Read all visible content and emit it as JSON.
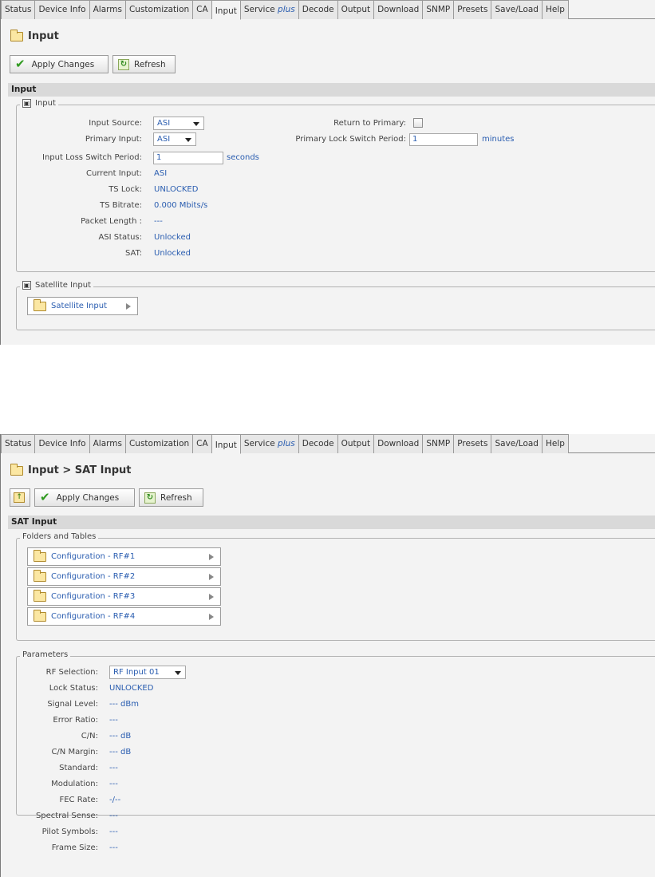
{
  "tabs": [
    {
      "label": "Status"
    },
    {
      "label": "Device Info"
    },
    {
      "label": "Alarms"
    },
    {
      "label": "Customization"
    },
    {
      "label": "CA"
    },
    {
      "label": "Input",
      "active": true
    },
    {
      "label": "Service ",
      "suffix": "plus"
    },
    {
      "label": "Decode"
    },
    {
      "label": "Output"
    },
    {
      "label": "Download"
    },
    {
      "label": "SNMP"
    },
    {
      "label": "Presets"
    },
    {
      "label": "Save/Load"
    },
    {
      "label": "Help"
    }
  ],
  "colors": {
    "value_blue": "#2a5db0",
    "section_gray": "#d9d9d9",
    "check_green": "#2f9a1f"
  },
  "toolbar": {
    "apply_label": "Apply Changes",
    "refresh_label": "Refresh"
  },
  "icons": {
    "folder": "folder-icon",
    "apply": "checkmark-icon",
    "refresh": "refresh-icon",
    "up": "folder-up-icon",
    "collapse": "collapse-icon",
    "expand_arrow": "right-triangle-icon",
    "dropdown_arrow": "chevron-down-icon"
  },
  "panel1": {
    "page_title": "Input",
    "section_title": "Input",
    "input_group": {
      "legend": "Input",
      "input_source": {
        "label": "Input Source:",
        "value": "ASI"
      },
      "primary_input": {
        "label": "Primary Input:",
        "value": "ASI"
      },
      "loss_switch": {
        "label": "Input Loss Switch Period:",
        "value": "1",
        "unit": "seconds"
      },
      "current_input": {
        "label": "Current Input:",
        "value": "ASI"
      },
      "ts_lock": {
        "label": "TS Lock:",
        "value": "UNLOCKED"
      },
      "ts_bitrate": {
        "label": "TS Bitrate:",
        "value": "0.000 Mbits/s"
      },
      "packet_length": {
        "label": "Packet Length :",
        "value": "---"
      },
      "asi_status": {
        "label": "ASI Status:",
        "value": "Unlocked"
      },
      "sat": {
        "label": "SAT:",
        "value": "Unlocked"
      },
      "return_primary": {
        "label": "Return to Primary:",
        "checked": false
      },
      "primary_lock_switch": {
        "label": "Primary Lock Switch Period:",
        "value": "1",
        "unit": "minutes"
      }
    },
    "satellite_group": {
      "legend": "Satellite Input",
      "button_label": "Satellite Input"
    }
  },
  "panel2": {
    "page_title": "Input > SAT Input",
    "section_title": "SAT Input",
    "folders": {
      "legend": "Folders and Tables",
      "items": [
        "Configuration - RF#1",
        "Configuration - RF#2",
        "Configuration - RF#3",
        "Configuration - RF#4"
      ]
    },
    "params": {
      "legend": "Parameters",
      "rf_selection": {
        "label": "RF Selection:",
        "value": "RF Input 01"
      },
      "rows": [
        {
          "label": "Lock Status:",
          "value": "UNLOCKED"
        },
        {
          "label": "Signal Level:",
          "value": "--- dBm"
        },
        {
          "label": "Error Ratio:",
          "value": "---"
        },
        {
          "label": "C/N:",
          "value": "--- dB"
        },
        {
          "label": "C/N Margin:",
          "value": "--- dB"
        },
        {
          "label": "Standard:",
          "value": "---"
        },
        {
          "label": "Modulation:",
          "value": "---"
        },
        {
          "label": "FEC Rate:",
          "value": "-/--"
        },
        {
          "label": "Spectral Sense:",
          "value": "---"
        },
        {
          "label": "Pilot Symbols:",
          "value": "---"
        },
        {
          "label": "Frame Size:",
          "value": "---"
        }
      ]
    }
  }
}
